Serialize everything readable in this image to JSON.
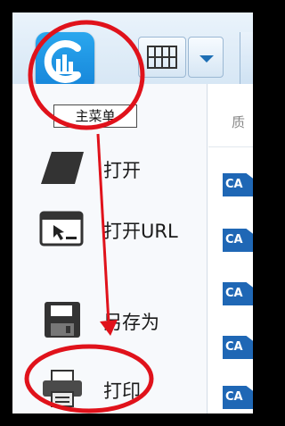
{
  "toolbar": {
    "main_menu_icon": "app-logo-icon",
    "layout_icon": "layout-grid-icon",
    "dropdown_icon": "chevron-down-icon"
  },
  "tooltip": {
    "text": "主菜单"
  },
  "menu": {
    "items": [
      {
        "label": "打开",
        "icon": "open-folder-icon"
      },
      {
        "label": "打开URL",
        "icon": "open-url-icon"
      },
      {
        "label": "另存为",
        "icon": "save-as-icon"
      },
      {
        "label": "打印",
        "icon": "printer-icon"
      }
    ]
  },
  "file_list": {
    "header": "质",
    "items": [
      {
        "badge": "CA"
      },
      {
        "badge": "CA"
      },
      {
        "badge": "CA"
      },
      {
        "badge": "CA"
      },
      {
        "badge": "CA"
      }
    ]
  },
  "colors": {
    "background": "#000000",
    "accent_blue": "#1a8fe3",
    "annotation_red": "#e0121b"
  }
}
